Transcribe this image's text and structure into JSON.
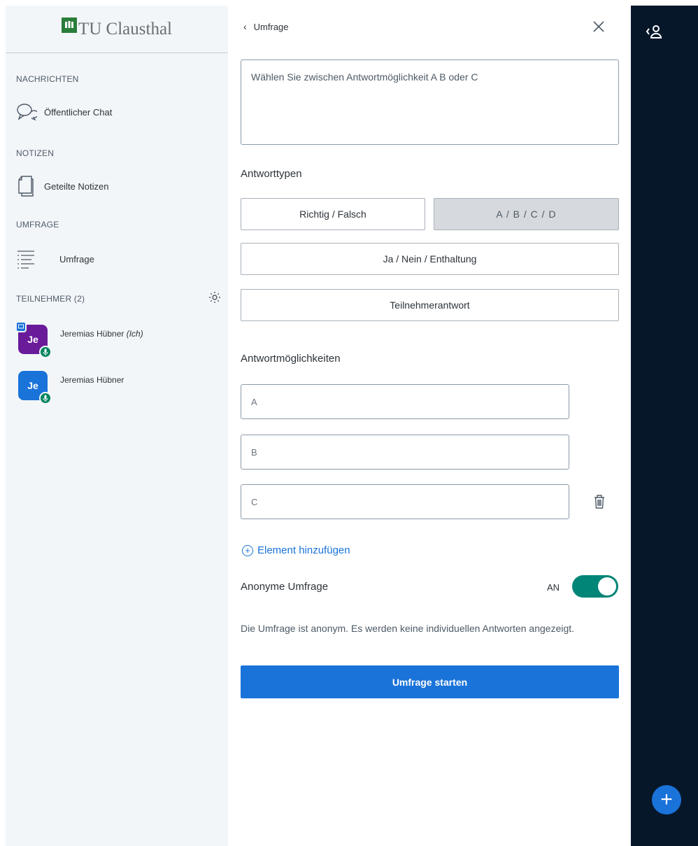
{
  "sidebar": {
    "logo_text": "TU Clausthal",
    "sections": {
      "messages": "NACHRICHTEN",
      "notes": "NOTIZEN",
      "poll": "UMFRAGE",
      "participants": "TEILNEHMER (2)"
    },
    "items": {
      "public_chat": "Öffentlicher Chat",
      "shared_notes": "Geteilte Notizen",
      "poll": "Umfrage"
    },
    "users": [
      {
        "initials": "Je",
        "name": "Jeremias Hübner",
        "suffix": "(Ich)",
        "color": "#6a1b9a"
      },
      {
        "initials": "Je",
        "name": "Jeremias Hübner",
        "suffix": "",
        "color": "#1a73d9"
      }
    ]
  },
  "panel": {
    "back_label": "Umfrage",
    "question": "Wählen Sie zwischen Antwortmöglichkeit A B oder C",
    "answer_types_label": "Antworttypen",
    "answer_types": {
      "true_false": "Richtig / Falsch",
      "abcd": "A / B / C / D",
      "yes_no_abstain": "Ja / Nein / Enthaltung",
      "user_response": "Teilnehmerantwort"
    },
    "options_label": "Antwortmöglichkeiten",
    "options": [
      "A",
      "B",
      "C"
    ],
    "add_item": "Element hinzufügen",
    "anonymous_label": "Anonyme Umfrage",
    "toggle_state": "AN",
    "anonymous_desc": "Die Umfrage ist anonym. Es werden keine individuellen Antworten angezeigt.",
    "start_button": "Umfrage starten"
  },
  "colors": {
    "accent": "#1a73d9",
    "toggle_on": "#008577",
    "dark_bar": "#06172a"
  }
}
